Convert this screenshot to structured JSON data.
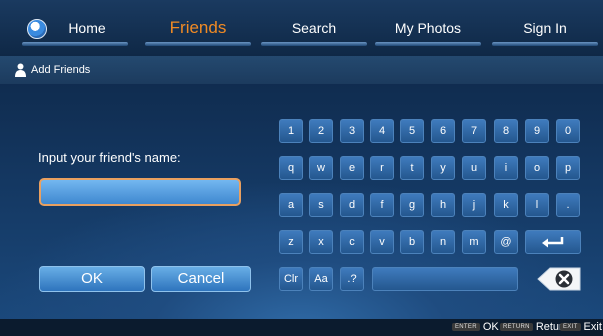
{
  "nav": {
    "tabs": [
      {
        "label": "Home",
        "icon": "home-icon"
      },
      {
        "label": "Friends",
        "active": true
      },
      {
        "label": "Search"
      },
      {
        "label": "My Photos"
      },
      {
        "label": "Sign In"
      }
    ],
    "active_color": "#f08a24"
  },
  "breadcrumb": {
    "label": "Add Friends",
    "icon": "person-icon"
  },
  "form": {
    "prompt": "Input your friend's name:",
    "input_value": "",
    "ok_label": "OK",
    "cancel_label": "Cancel"
  },
  "keyboard": {
    "row1": [
      "1",
      "2",
      "3",
      "4",
      "5",
      "6",
      "7",
      "8",
      "9",
      "0"
    ],
    "row2": [
      "q",
      "w",
      "e",
      "r",
      "t",
      "y",
      "u",
      "i",
      "o",
      "p"
    ],
    "row3": [
      "a",
      "s",
      "d",
      "f",
      "g",
      "h",
      "j",
      "k",
      "l",
      "."
    ],
    "row4": [
      "z",
      "x",
      "c",
      "v",
      "b",
      "n",
      "m",
      "@"
    ],
    "row4_enter_icon": "enter-arrow-icon",
    "row5": [
      "Clr",
      "Aa",
      ".?"
    ],
    "space_icon": "space-key",
    "backspace_icon": "backspace-icon"
  },
  "footer": {
    "hints": [
      {
        "badge": "ENTER",
        "label": "OK"
      },
      {
        "badge": "RETURN",
        "label": "Return"
      },
      {
        "badge": "EXIT",
        "label": "Exit"
      }
    ]
  }
}
